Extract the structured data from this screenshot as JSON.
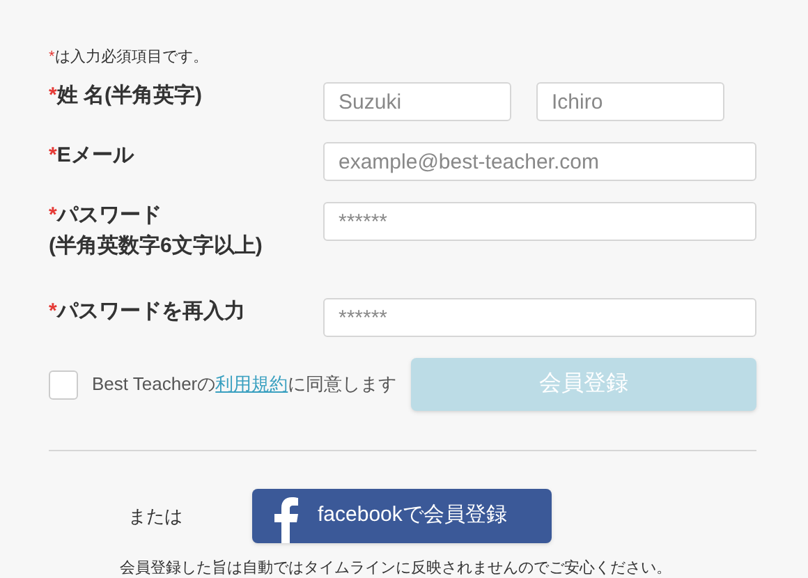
{
  "note": {
    "mark": "*",
    "text": "は入力必須項目です。"
  },
  "fields": [
    {
      "kind": "pair",
      "mark": "*",
      "label": "姓 名(半角英字)",
      "inputs": [
        {
          "placeholder": "Suzuki"
        },
        {
          "placeholder": "Ichiro"
        }
      ]
    },
    {
      "kind": "single",
      "mark": "*",
      "label": "Eメール",
      "inputs": [
        {
          "placeholder": "example@best-teacher.com"
        }
      ]
    },
    {
      "kind": "single",
      "mark": "*",
      "label": "パスワード",
      "sublabel": "(半角英数字6文字以上)",
      "inputs": [
        {
          "placeholder": "******"
        }
      ]
    },
    {
      "kind": "single",
      "mark": "*",
      "label": "パスワードを再入力",
      "inputs": [
        {
          "placeholder": "******"
        }
      ]
    }
  ],
  "agreement": {
    "checked": false,
    "before": "Best Teacherの",
    "link": "利用規約",
    "after": "に同意します"
  },
  "register_button": {
    "label": "会員登録",
    "disabled": true
  },
  "or_text": "または",
  "facebook_button": {
    "label": "facebookで会員登録"
  },
  "footnote": "会員登録した旨は自動ではタイムラインに反映されませんのでご安心ください。"
}
